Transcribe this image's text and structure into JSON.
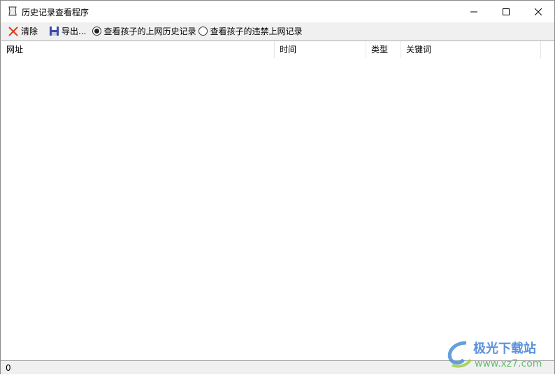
{
  "window": {
    "title": "历史记录查看程序"
  },
  "toolbar": {
    "clear_label": "清除",
    "export_label": "导出...",
    "radio_history": "查看孩子的上网历史记录",
    "radio_banned": "查看孩子的违禁上网记录",
    "selected": "radio_history"
  },
  "table": {
    "columns": [
      "网址",
      "时间",
      "类型",
      "关键词"
    ],
    "rows": []
  },
  "status": {
    "count": "0"
  },
  "watermark": {
    "name": "极光下载站",
    "url": "www.xz7.com"
  }
}
